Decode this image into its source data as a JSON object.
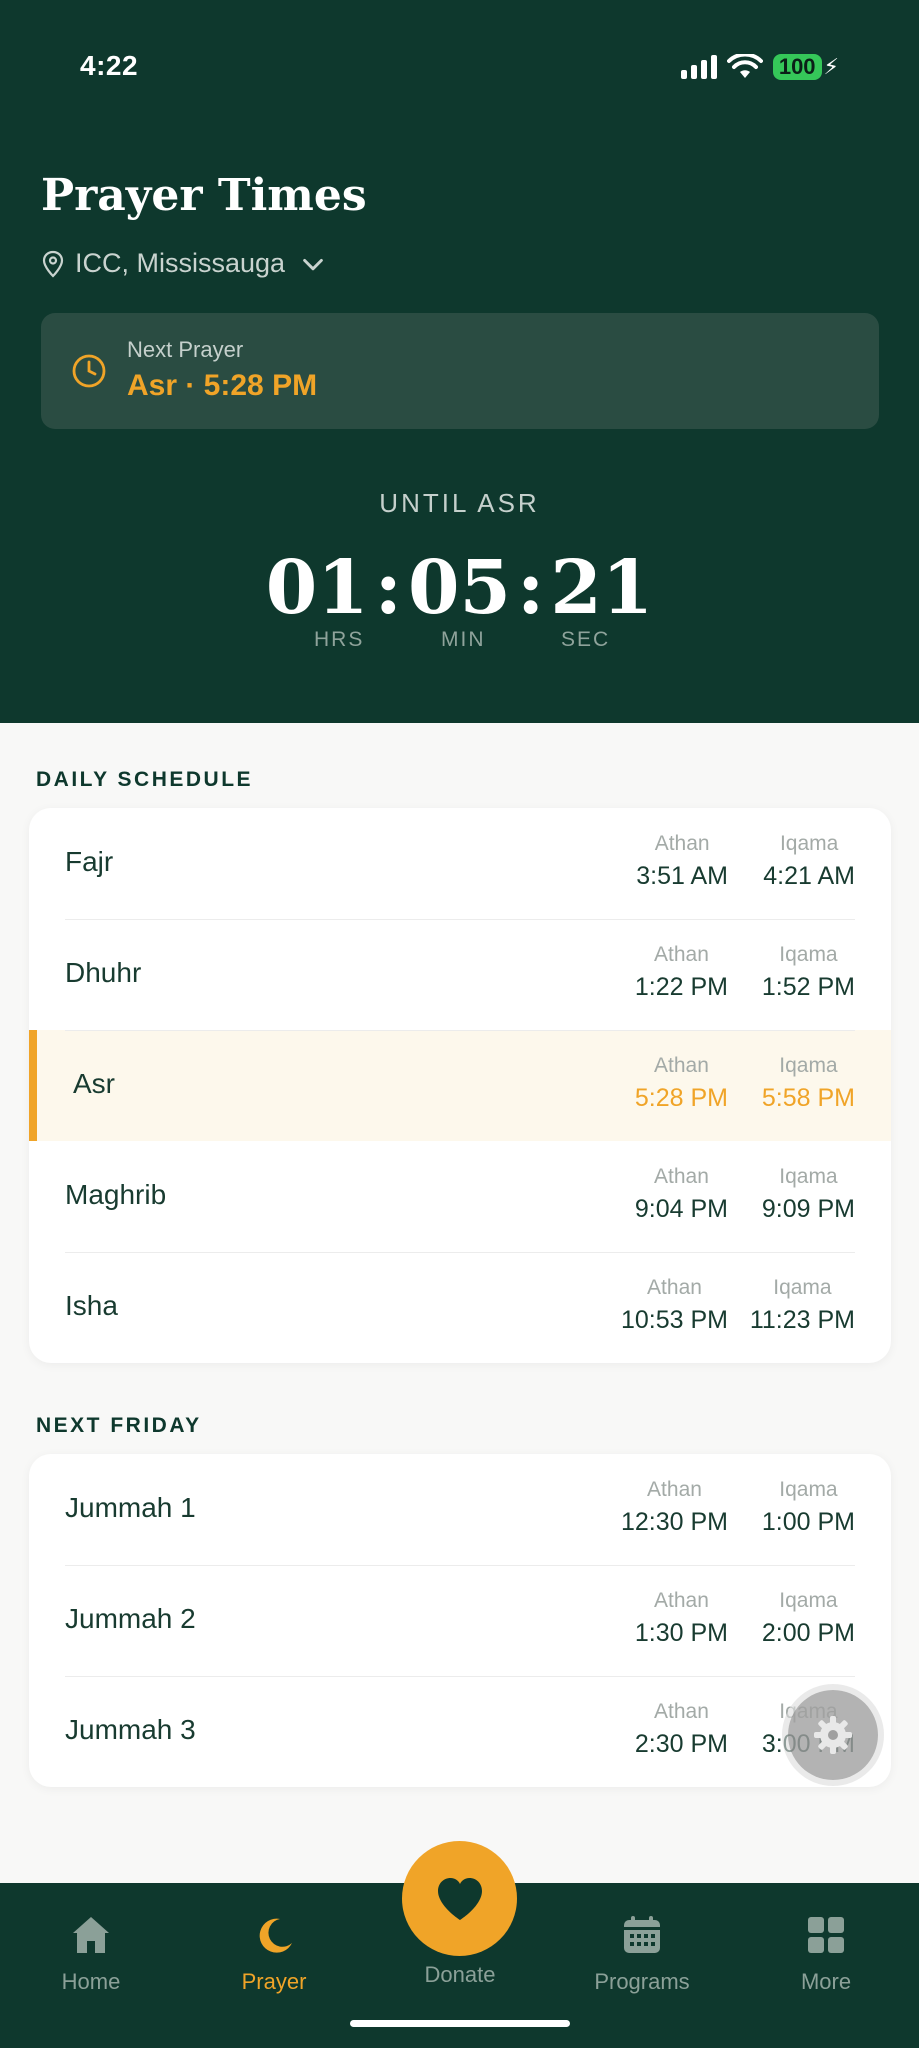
{
  "status_bar": {
    "time": "4:22",
    "battery": "100"
  },
  "header": {
    "title": "Prayer Times",
    "location": "ICC, Mississauga",
    "next_prayer_label": "Next Prayer",
    "next_prayer_value": "Asr · 5:28 PM",
    "until_label": "UNTIL ASR",
    "countdown": {
      "hours": "01",
      "minutes": "05",
      "seconds": "21"
    },
    "countdown_units": {
      "hours": "HRS",
      "minutes": "MIN",
      "seconds": "SEC"
    }
  },
  "daily_schedule": {
    "title": "DAILY SCHEDULE",
    "athan_label": "Athan",
    "iqama_label": "Iqama",
    "rows": [
      {
        "name": "Fajr",
        "athan": "3:51 AM",
        "iqama": "4:21 AM"
      },
      {
        "name": "Dhuhr",
        "athan": "1:22 PM",
        "iqama": "1:52 PM"
      },
      {
        "name": "Asr",
        "athan": "5:28 PM",
        "iqama": "5:58 PM"
      },
      {
        "name": "Maghrib",
        "athan": "9:04 PM",
        "iqama": "9:09 PM"
      },
      {
        "name": "Isha",
        "athan": "10:53 PM",
        "iqama": "11:23 PM"
      }
    ]
  },
  "next_friday": {
    "title": "NEXT FRIDAY",
    "athan_label": "Athan",
    "iqama_label": "Iqama",
    "rows": [
      {
        "name": "Jummah 1",
        "athan": "12:30 PM",
        "iqama": "1:00 PM"
      },
      {
        "name": "Jummah 2",
        "athan": "1:30 PM",
        "iqama": "2:00 PM"
      },
      {
        "name": "Jummah 3",
        "athan": "2:30 PM",
        "iqama": "3:00 PM"
      }
    ]
  },
  "tabbar": {
    "home": "Home",
    "prayer": "Prayer",
    "donate": "Donate",
    "programs": "Programs",
    "more": "More"
  },
  "colors": {
    "primary": "#0e382d",
    "accent": "#f0a428",
    "active_row": "#fdf8ec"
  }
}
